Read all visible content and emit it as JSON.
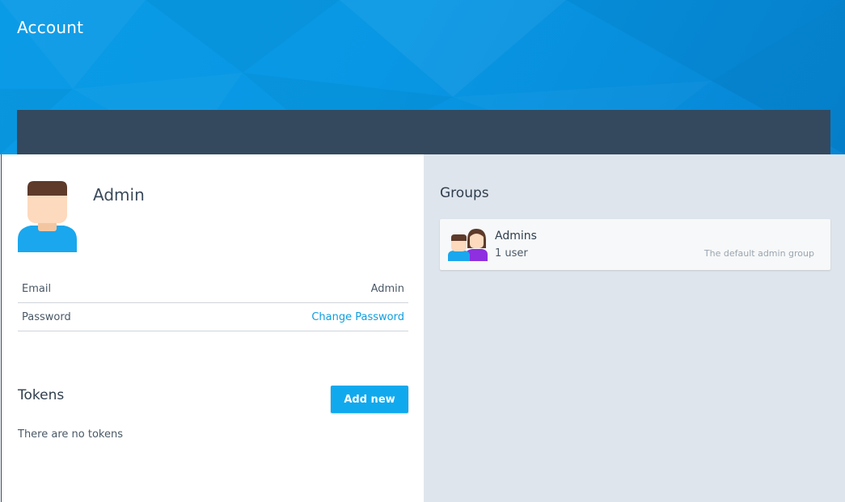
{
  "header": {
    "title": "Account"
  },
  "profile": {
    "name": "Admin",
    "avatar_icon": "user-avatar-icon",
    "rows": [
      {
        "label": "Email",
        "value": "Admin"
      },
      {
        "label": "Password",
        "value": "Change Password"
      }
    ]
  },
  "tokens": {
    "title": "Tokens",
    "add_label": "Add new",
    "empty_text": "There are no tokens"
  },
  "groups": {
    "title": "Groups",
    "items": [
      {
        "name": "Admins",
        "count": "1 user",
        "description": "The default admin group",
        "icon": "group-users-icon"
      }
    ]
  },
  "colors": {
    "header_blue": "#0a9be6",
    "dark_band": "#34495e",
    "accent": "#11a9ee",
    "right_pane": "#dfe5ec"
  }
}
